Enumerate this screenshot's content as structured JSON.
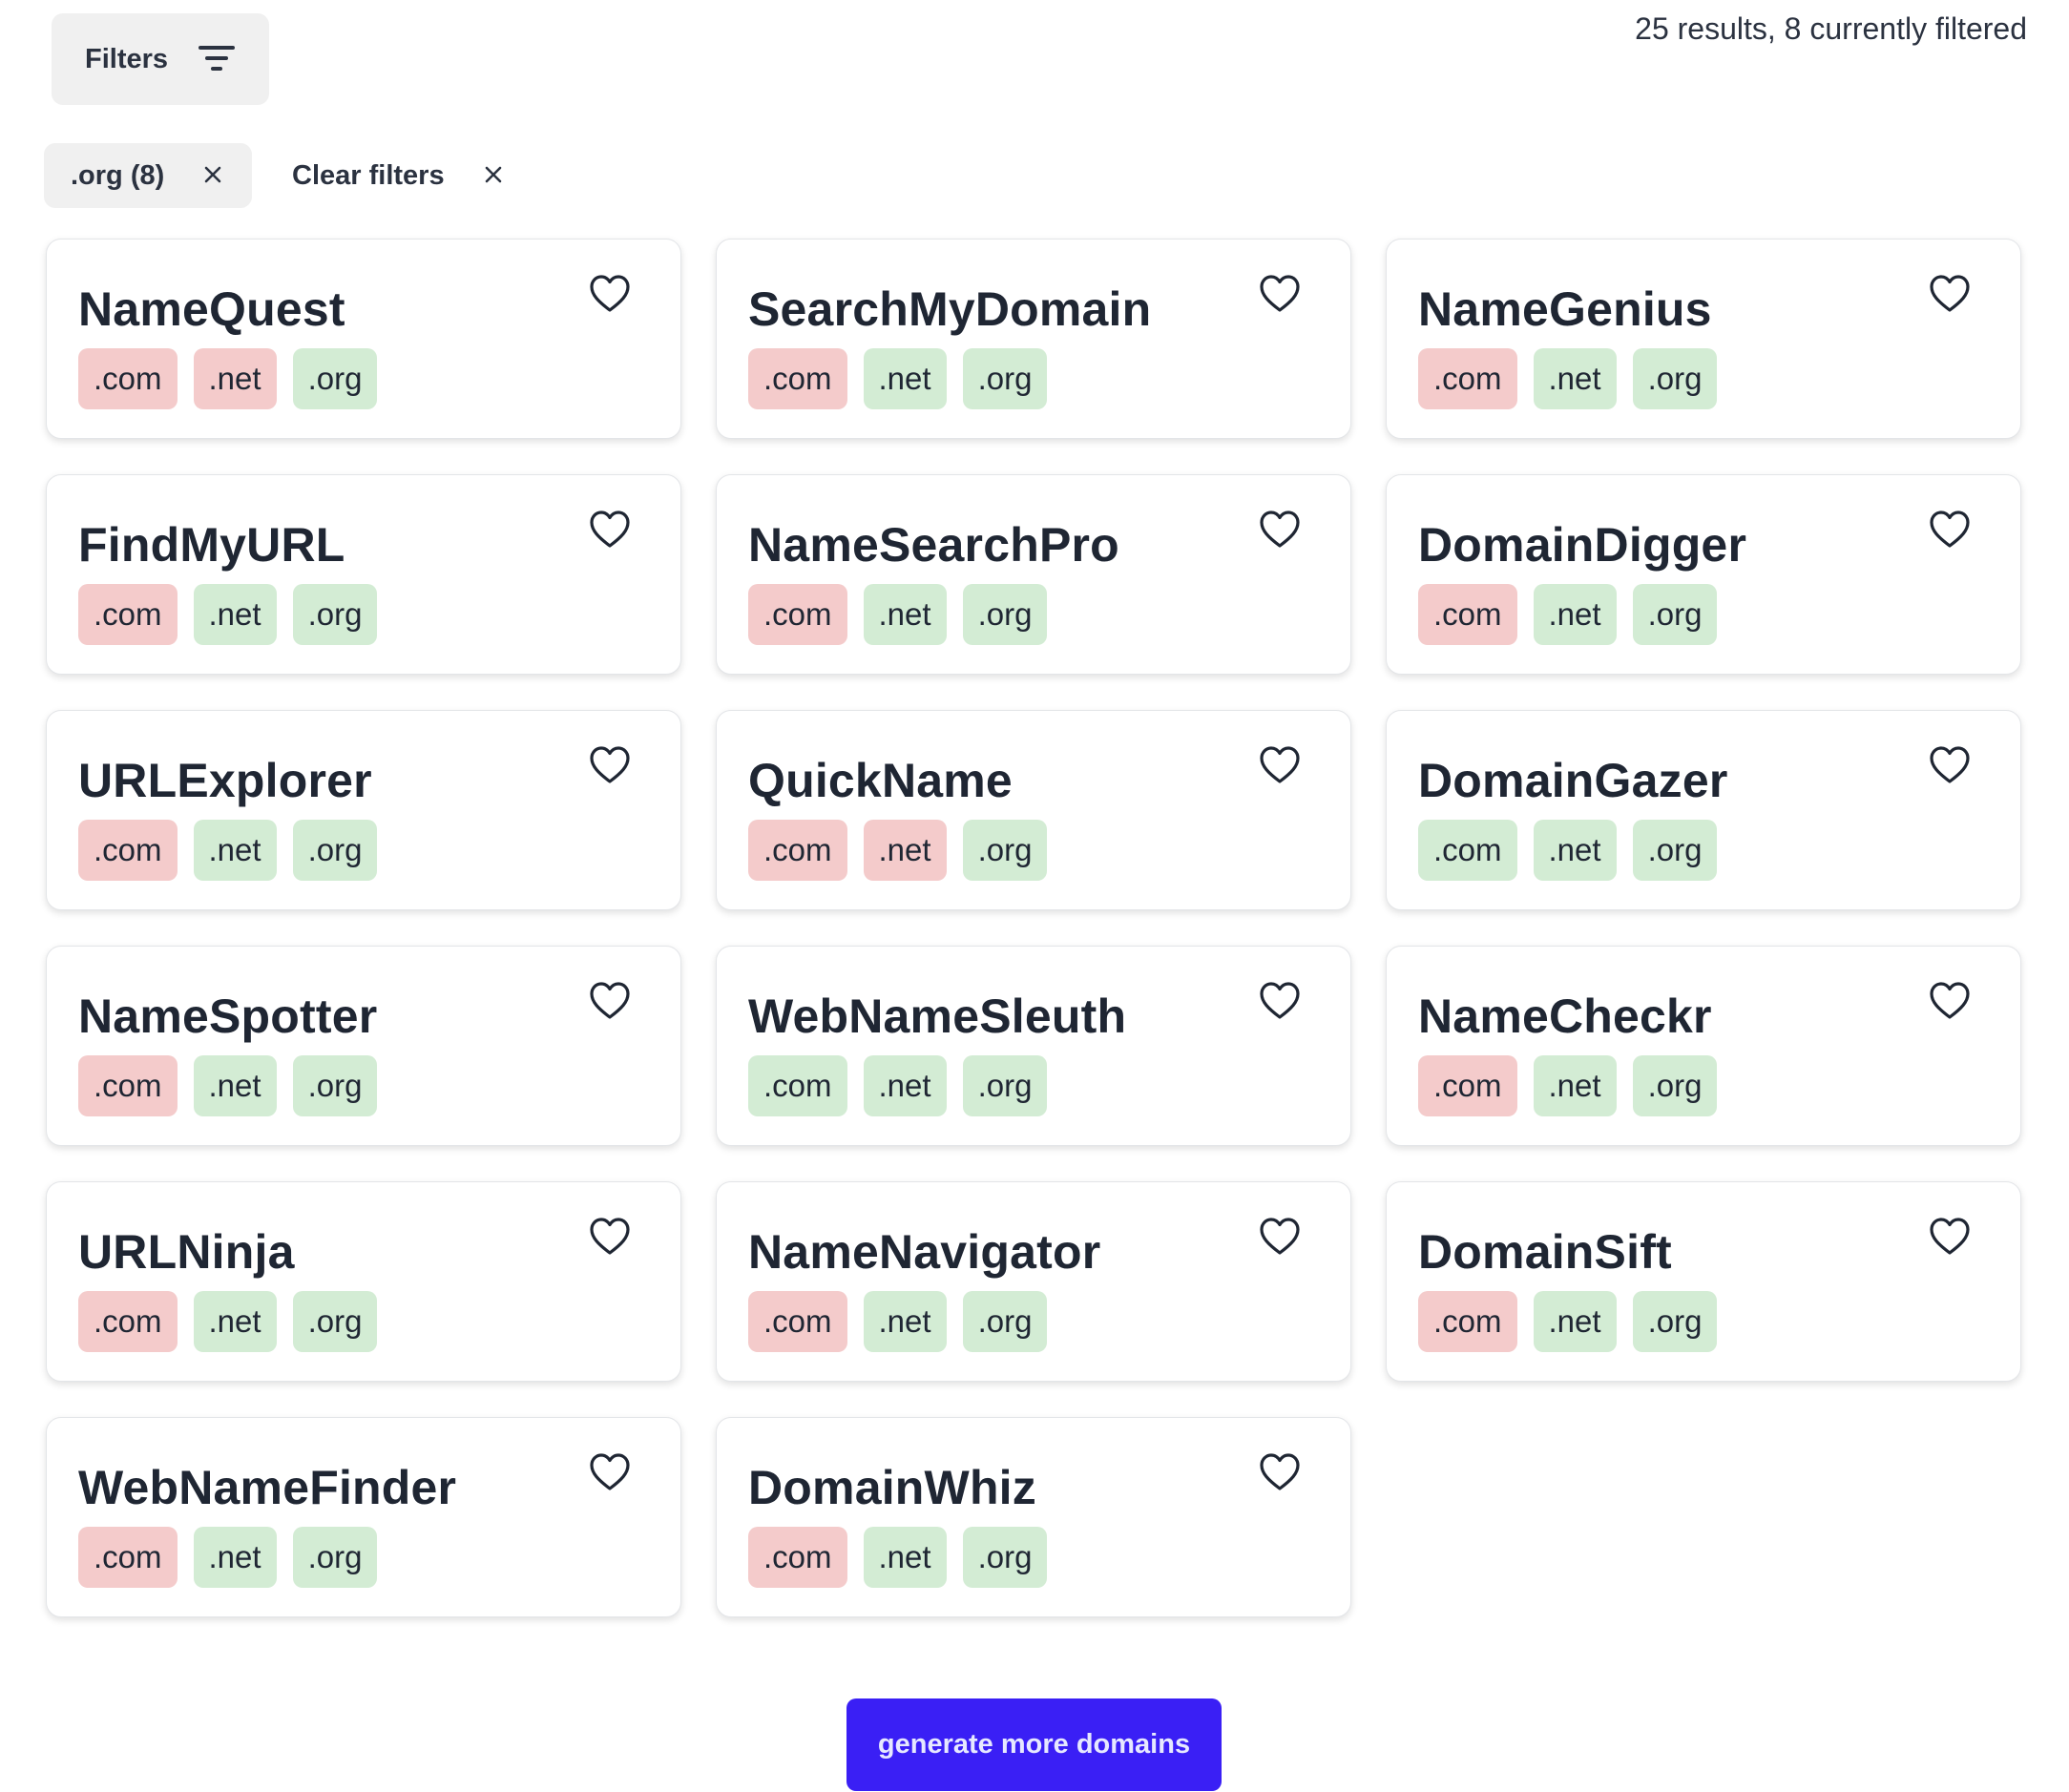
{
  "toolbar": {
    "filters_label": "Filters",
    "results_text": "25 results, 8 currently filtered"
  },
  "active_filters": {
    "chip_label": ".org (8)",
    "clear_label": "Clear filters"
  },
  "colors": {
    "taken": "#f4cbcb",
    "available": "#d3ecd4",
    "primary_button": "#3a1ff5"
  },
  "domains": [
    {
      "name": "NameQuest",
      "tlds": [
        {
          "label": ".com",
          "available": false
        },
        {
          "label": ".net",
          "available": false
        },
        {
          "label": ".org",
          "available": true
        }
      ]
    },
    {
      "name": "SearchMyDomain",
      "tlds": [
        {
          "label": ".com",
          "available": false
        },
        {
          "label": ".net",
          "available": true
        },
        {
          "label": ".org",
          "available": true
        }
      ]
    },
    {
      "name": "NameGenius",
      "tlds": [
        {
          "label": ".com",
          "available": false
        },
        {
          "label": ".net",
          "available": true
        },
        {
          "label": ".org",
          "available": true
        }
      ]
    },
    {
      "name": "FindMyURL",
      "tlds": [
        {
          "label": ".com",
          "available": false
        },
        {
          "label": ".net",
          "available": true
        },
        {
          "label": ".org",
          "available": true
        }
      ]
    },
    {
      "name": "NameSearchPro",
      "tlds": [
        {
          "label": ".com",
          "available": false
        },
        {
          "label": ".net",
          "available": true
        },
        {
          "label": ".org",
          "available": true
        }
      ]
    },
    {
      "name": "DomainDigger",
      "tlds": [
        {
          "label": ".com",
          "available": false
        },
        {
          "label": ".net",
          "available": true
        },
        {
          "label": ".org",
          "available": true
        }
      ]
    },
    {
      "name": "URLExplorer",
      "tlds": [
        {
          "label": ".com",
          "available": false
        },
        {
          "label": ".net",
          "available": true
        },
        {
          "label": ".org",
          "available": true
        }
      ]
    },
    {
      "name": "QuickName",
      "tlds": [
        {
          "label": ".com",
          "available": false
        },
        {
          "label": ".net",
          "available": false
        },
        {
          "label": ".org",
          "available": true
        }
      ]
    },
    {
      "name": "DomainGazer",
      "tlds": [
        {
          "label": ".com",
          "available": true
        },
        {
          "label": ".net",
          "available": true
        },
        {
          "label": ".org",
          "available": true
        }
      ]
    },
    {
      "name": "NameSpotter",
      "tlds": [
        {
          "label": ".com",
          "available": false
        },
        {
          "label": ".net",
          "available": true
        },
        {
          "label": ".org",
          "available": true
        }
      ]
    },
    {
      "name": "WebNameSleuth",
      "tlds": [
        {
          "label": ".com",
          "available": true
        },
        {
          "label": ".net",
          "available": true
        },
        {
          "label": ".org",
          "available": true
        }
      ]
    },
    {
      "name": "NameCheckr",
      "tlds": [
        {
          "label": ".com",
          "available": false
        },
        {
          "label": ".net",
          "available": true
        },
        {
          "label": ".org",
          "available": true
        }
      ]
    },
    {
      "name": "URLNinja",
      "tlds": [
        {
          "label": ".com",
          "available": false
        },
        {
          "label": ".net",
          "available": true
        },
        {
          "label": ".org",
          "available": true
        }
      ]
    },
    {
      "name": "NameNavigator",
      "tlds": [
        {
          "label": ".com",
          "available": false
        },
        {
          "label": ".net",
          "available": true
        },
        {
          "label": ".org",
          "available": true
        }
      ]
    },
    {
      "name": "DomainSift",
      "tlds": [
        {
          "label": ".com",
          "available": false
        },
        {
          "label": ".net",
          "available": true
        },
        {
          "label": ".org",
          "available": true
        }
      ]
    },
    {
      "name": "WebNameFinder",
      "tlds": [
        {
          "label": ".com",
          "available": false
        },
        {
          "label": ".net",
          "available": true
        },
        {
          "label": ".org",
          "available": true
        }
      ]
    },
    {
      "name": "DomainWhiz",
      "tlds": [
        {
          "label": ".com",
          "available": false
        },
        {
          "label": ".net",
          "available": true
        },
        {
          "label": ".org",
          "available": true
        }
      ]
    }
  ],
  "footer": {
    "generate_label": "generate more domains"
  }
}
